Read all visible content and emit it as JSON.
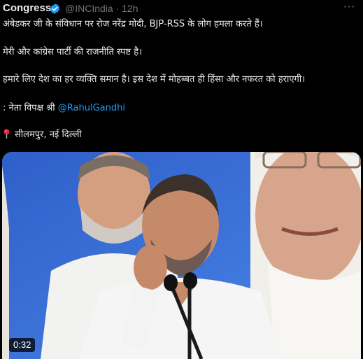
{
  "tweet": {
    "author_name": "Congress",
    "handle_time": "@INCIndia · 12h",
    "line1": "अंबेडकर जी के संविधान पर रोज नरेंद्र मोदी, BJP-RSS के लोग हमला करते हैं।",
    "line2": "मेरी और कांग्रेस पार्टी की राजनीति स्पष्ट है।",
    "line3": "हमारे लिए देश का हर व्यक्ति समान है। इस देश में मोहब्बत ही हिंसा और नफरत को हराएगी।",
    "line4_prefix": ": नेता विपक्ष श्री ",
    "mention": "@RahulGandhi",
    "location": "सीलमपुर, नई दिल्ली"
  },
  "video": {
    "duration": "0:32"
  },
  "icons": {
    "verified": "verified-badge-icon",
    "more": "more-options-icon",
    "location": "round-pushpin-icon"
  },
  "colors": {
    "background": "#000000",
    "text": "#e7e9ea",
    "secondary_text": "#71767b",
    "link": "#1d9bf0",
    "verified": "#1d9bf0",
    "poster_blue": "#3a6fd6"
  }
}
